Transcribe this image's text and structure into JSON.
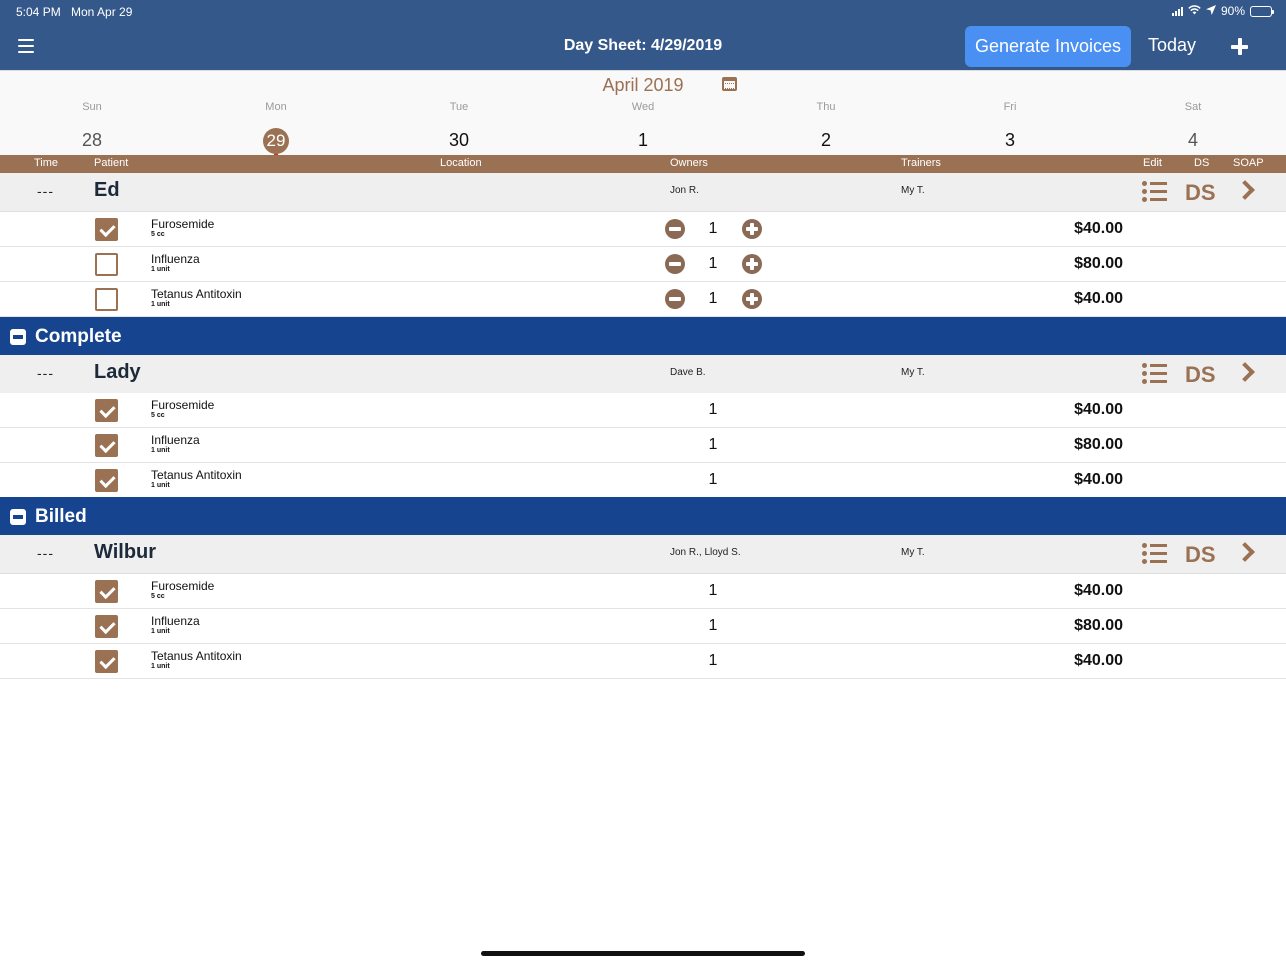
{
  "status_bar": {
    "time": "5:04 PM",
    "date": "Mon Apr 29",
    "battery": "90%"
  },
  "header": {
    "title": "Day Sheet: 4/29/2019",
    "generate_label": "Generate Invoices",
    "today_label": "Today",
    "menu_icon": "hamburger-menu-icon",
    "add_icon": "plus-icon"
  },
  "calendar": {
    "month": "April 2019",
    "days": [
      {
        "dow": "Sun",
        "num": "28"
      },
      {
        "dow": "Mon",
        "num": "29"
      },
      {
        "dow": "Tue",
        "num": "30"
      },
      {
        "dow": "Wed",
        "num": "1"
      },
      {
        "dow": "Thu",
        "num": "2"
      },
      {
        "dow": "Fri",
        "num": "3"
      },
      {
        "dow": "Sat",
        "num": "4"
      }
    ],
    "selected": "29"
  },
  "columns": {
    "time": "Time",
    "patient": "Patient",
    "location": "Location",
    "owners": "Owners",
    "trainers": "Trainers",
    "edit": "Edit",
    "ds": "DS",
    "soap": "SOAP"
  },
  "groups": [
    {
      "patient": {
        "time": "---",
        "name": "Ed",
        "owners": "Jon R.",
        "trainers": "My T.",
        "ds": "DS"
      },
      "items": [
        {
          "name": "Furosemide",
          "unit": "5 cc",
          "qty": "1",
          "price": "$40.00",
          "checked": true
        },
        {
          "name": "Influenza",
          "unit": "1 unit",
          "qty": "1",
          "price": "$80.00",
          "checked": false
        },
        {
          "name": "Tetanus Antitoxin",
          "unit": "1 unit",
          "qty": "1",
          "price": "$40.00",
          "checked": false
        }
      ]
    },
    {
      "section": "Complete",
      "patient": {
        "time": "---",
        "name": "Lady",
        "owners": "Dave B.",
        "trainers": "My T.",
        "ds": "DS"
      },
      "items": [
        {
          "name": "Furosemide",
          "unit": "5 cc",
          "qty": "1",
          "price": "$40.00",
          "checked": true
        },
        {
          "name": "Influenza",
          "unit": "1 unit",
          "qty": "1",
          "price": "$80.00",
          "checked": true
        },
        {
          "name": "Tetanus Antitoxin",
          "unit": "1 unit",
          "qty": "1",
          "price": "$40.00",
          "checked": true
        }
      ]
    },
    {
      "section": "Billed",
      "patient": {
        "time": "---",
        "name": "Wilbur",
        "owners": "Jon R., Lloyd S.",
        "trainers": "My T.",
        "ds": "DS"
      },
      "items": [
        {
          "name": "Furosemide",
          "unit": "5 cc",
          "qty": "1",
          "price": "$40.00",
          "checked": true
        },
        {
          "name": "Influenza",
          "unit": "1 unit",
          "qty": "1",
          "price": "$80.00",
          "checked": true
        },
        {
          "name": "Tetanus Antitoxin",
          "unit": "1 unit",
          "qty": "1",
          "price": "$40.00",
          "checked": true
        }
      ]
    }
  ],
  "colors": {
    "header_blue": "#35588b",
    "accent_brown": "#9b7153",
    "section_blue": "#17448f",
    "button_blue": "#4a8ff2"
  }
}
